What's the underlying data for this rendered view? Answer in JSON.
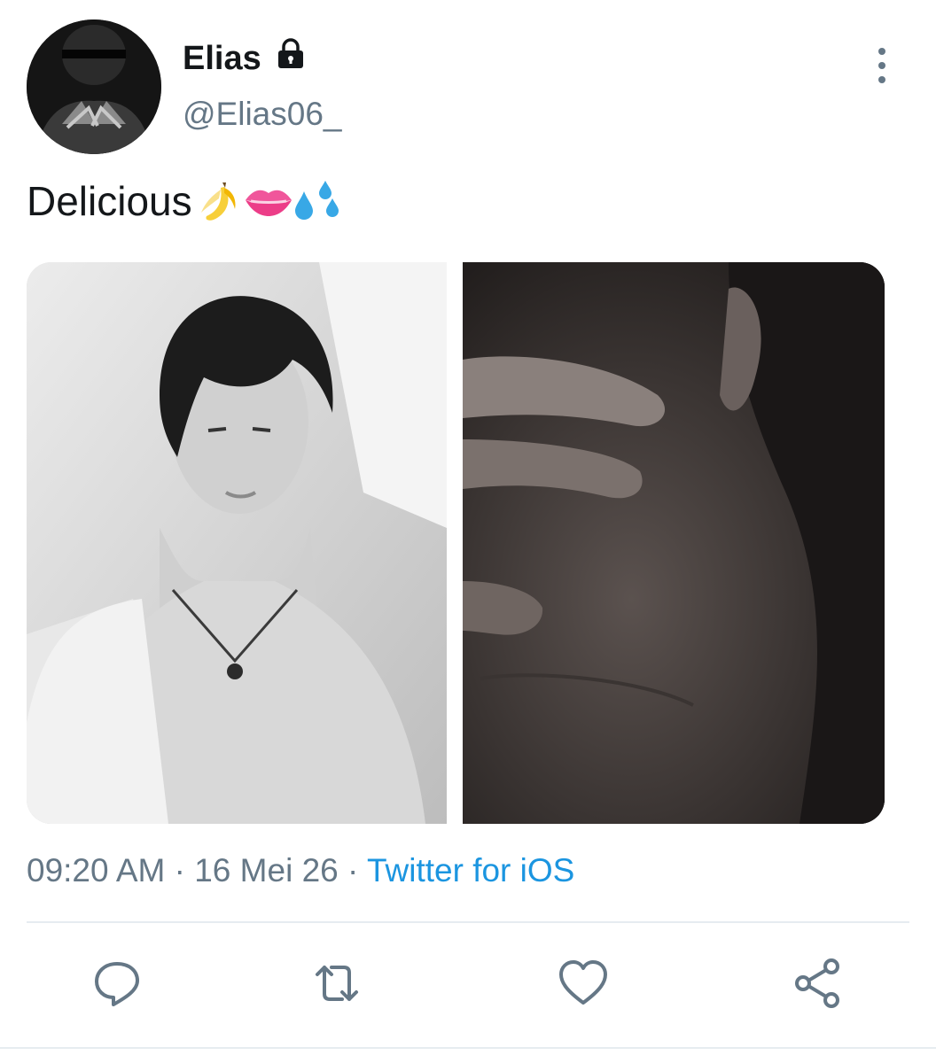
{
  "tweet": {
    "author_name": "Elias",
    "author_handle": "@Elias06_",
    "text": "Delicious",
    "emojis": [
      "banana-emoji",
      "lips-emoji",
      "sweat-droplets-emoji"
    ],
    "time": "09:20 AM",
    "separator": " · ",
    "date": "16 Mei 26",
    "source": "Twitter for iOS"
  },
  "icons": {
    "lock": "lock-icon",
    "more": "more-vertical-icon",
    "reply": "reply-icon",
    "retweet": "retweet-icon",
    "like": "heart-icon",
    "share": "share-icon"
  },
  "colors": {
    "text": "#14171a",
    "secondary": "#657786",
    "link": "#1b95e0",
    "divider": "#e6ecf0"
  }
}
